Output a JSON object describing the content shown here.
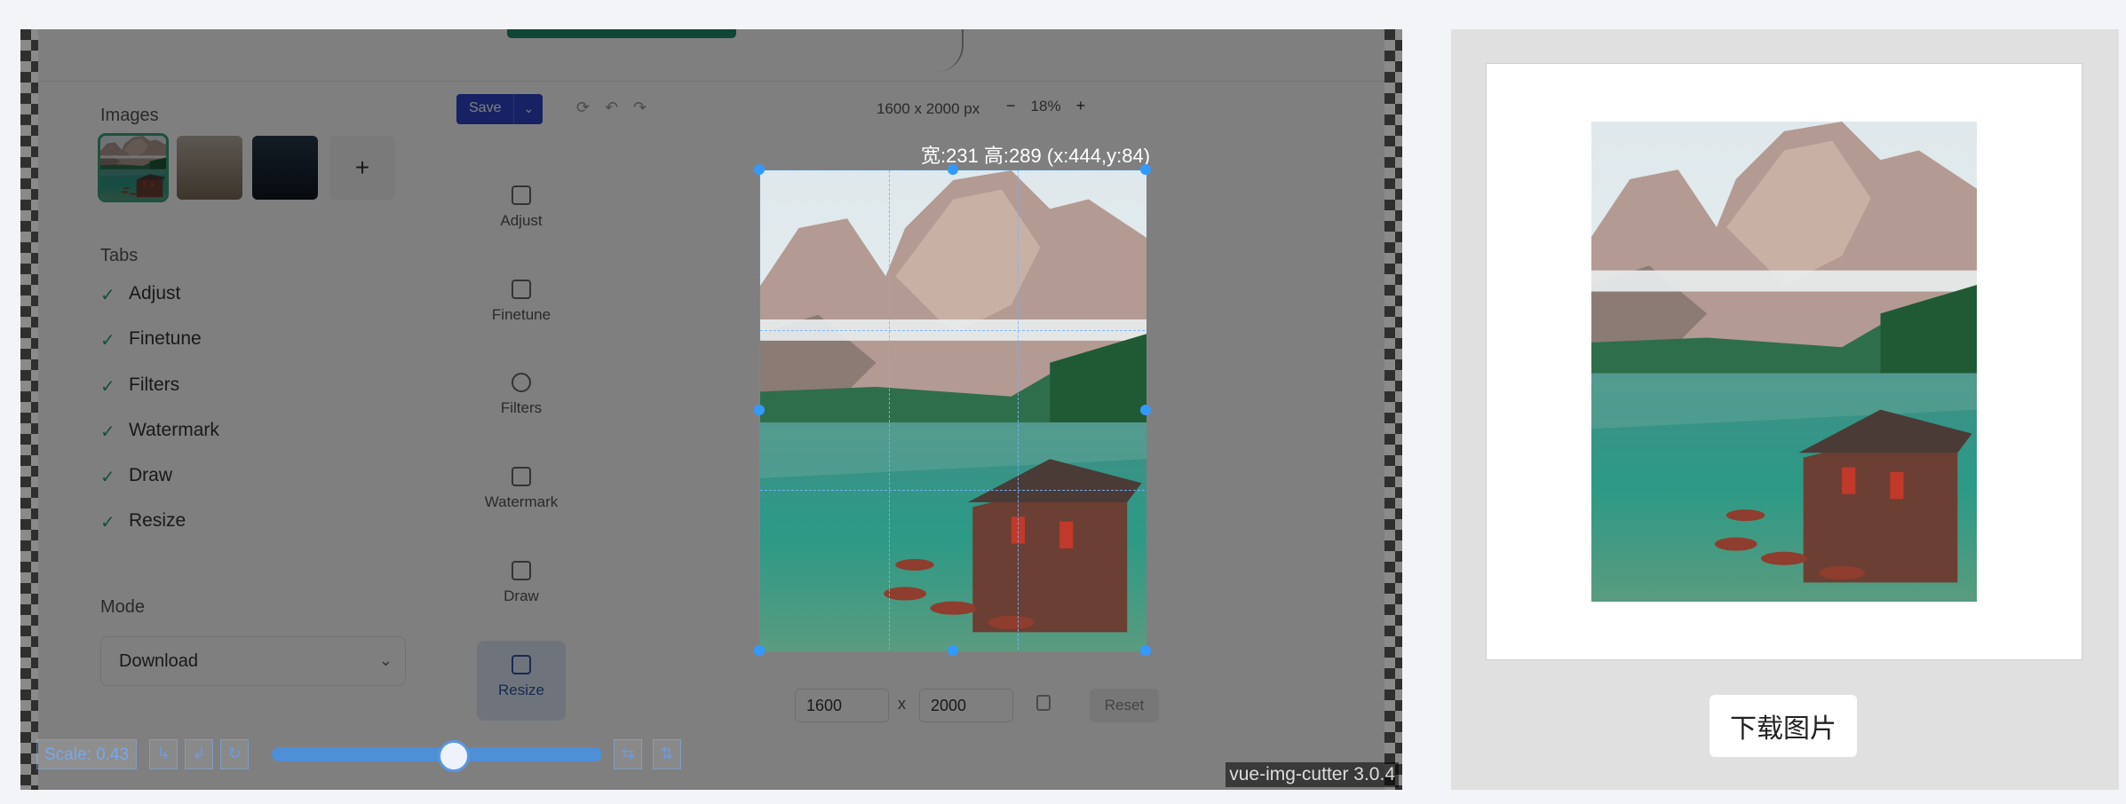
{
  "sidebar": {
    "images_heading": "Images",
    "add_label": "+",
    "tabs_heading": "Tabs",
    "tabs": [
      "Adjust",
      "Finetune",
      "Filters",
      "Watermark",
      "Draw",
      "Resize"
    ],
    "check_glyph": "✓",
    "mode_heading": "Mode",
    "mode_value": "Download",
    "mode_chevron": "⌄"
  },
  "toolbar": {
    "save_label": "Save",
    "save_dropdown": "⌄",
    "dimensions": "1600 x 2000 px",
    "zoom_minus": "−",
    "zoom_value": "18%",
    "zoom_plus": "+",
    "tools": [
      "Adjust",
      "Finetune",
      "Filters",
      "Watermark",
      "Draw",
      "Resize"
    ],
    "active_tool": "Resize",
    "width_value": "1600",
    "height_value": "2000",
    "x_sep": "x",
    "reset_label": "Reset"
  },
  "crop": {
    "info": "宽:231 高:289 (x:444,y:84)"
  },
  "controls": {
    "scale_label": "Scale: 0.43",
    "turn_left": "↳",
    "turn_down": "↲",
    "rotate": "↻",
    "flip_h": "⇆",
    "flip_v": "⇅",
    "scale_value": 0.43
  },
  "version": "vue-img-cutter 3.0.4",
  "preview": {
    "download_label": "下载图片"
  },
  "colors": {
    "accent": "#3399ff",
    "mask": "rgba(0,0,0,0.5)",
    "slider": "#4e8fd8"
  }
}
